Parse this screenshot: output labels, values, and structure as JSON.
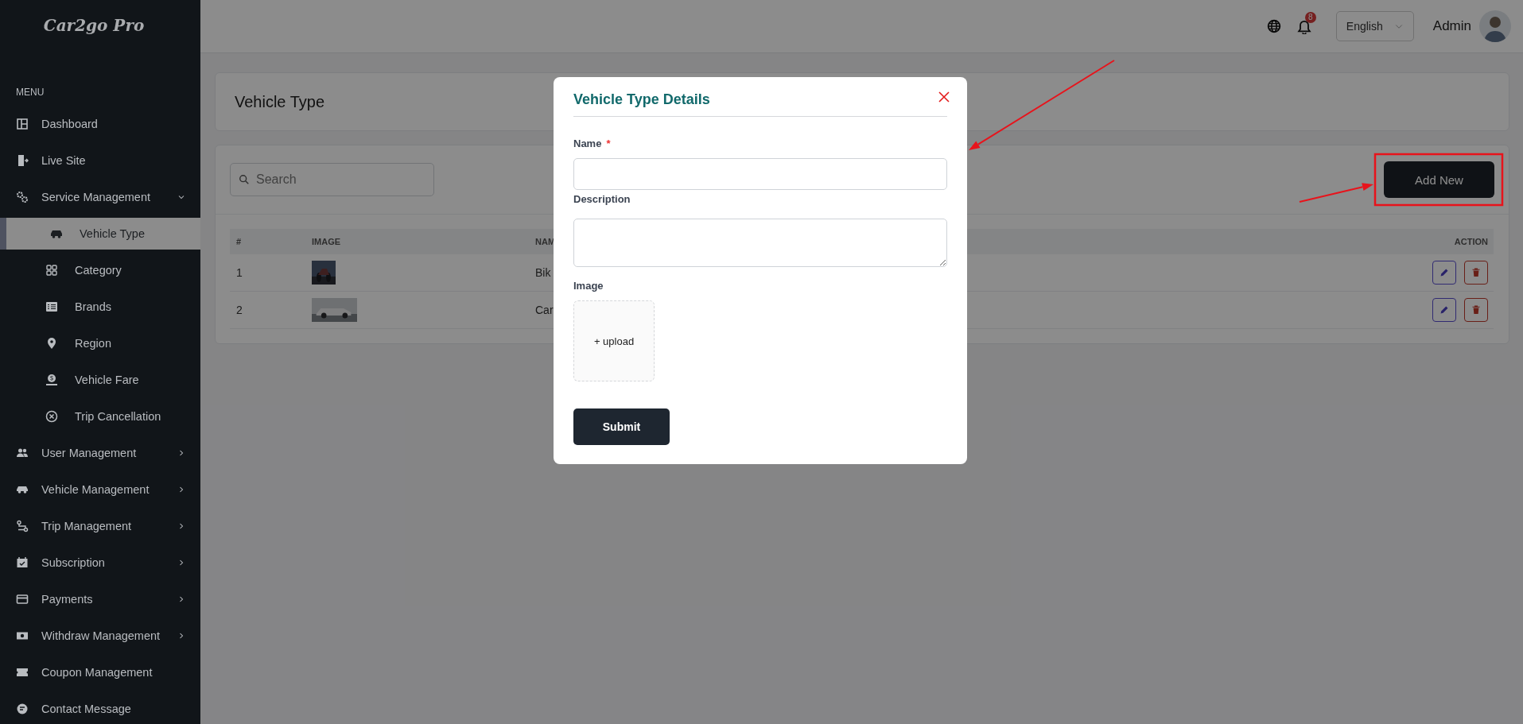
{
  "sidebar": {
    "logo": "Car2go Pro",
    "menu_label": "MENU",
    "items": [
      {
        "label": "Dashboard",
        "kind": "link",
        "selected": false
      },
      {
        "label": "Live Site",
        "kind": "link",
        "selected": false
      },
      {
        "label": "Service Management",
        "kind": "group",
        "expanded": true,
        "selected": false,
        "children": [
          {
            "label": "Vehicle Type",
            "selected": true
          },
          {
            "label": "Category",
            "selected": false
          },
          {
            "label": "Brands",
            "selected": false
          },
          {
            "label": "Region",
            "selected": false
          },
          {
            "label": "Vehicle Fare",
            "selected": false
          },
          {
            "label": "Trip Cancellation",
            "selected": false
          }
        ]
      },
      {
        "label": "User Management",
        "kind": "group",
        "expanded": false,
        "selected": false
      },
      {
        "label": "Vehicle Management",
        "kind": "group",
        "expanded": false,
        "selected": false
      },
      {
        "label": "Trip Management",
        "kind": "group",
        "expanded": false,
        "selected": false
      },
      {
        "label": "Subscription",
        "kind": "group",
        "expanded": false,
        "selected": false
      },
      {
        "label": "Payments",
        "kind": "group",
        "expanded": false,
        "selected": false
      },
      {
        "label": "Withdraw Management",
        "kind": "group",
        "expanded": false,
        "selected": false
      },
      {
        "label": "Coupon Management",
        "kind": "link",
        "selected": false
      },
      {
        "label": "Contact Message",
        "kind": "link",
        "selected": false
      }
    ]
  },
  "header": {
    "notification_count": "8",
    "language": "English",
    "user_name": "Admin"
  },
  "page": {
    "title": "Vehicle Type",
    "search": {
      "placeholder": "Search"
    },
    "add_button": "Add New",
    "table": {
      "columns": [
        "#",
        "IMAGE",
        "NAM",
        "ACTION"
      ],
      "rows": [
        {
          "index": "1",
          "name": "Bik"
        },
        {
          "index": "2",
          "name": "Car"
        }
      ]
    }
  },
  "modal": {
    "title": "Vehicle Type Details",
    "fields": [
      {
        "kind": "input",
        "label": "Name",
        "required_mark": "*"
      },
      {
        "kind": "textarea",
        "label": "Description"
      },
      {
        "kind": "upload",
        "label": "Image",
        "upload_text": "+ upload"
      }
    ],
    "submit": "Submit"
  },
  "annotations": [
    {
      "kind": "arrow"
    },
    {
      "kind": "arrow"
    },
    {
      "kind": "frame"
    }
  ]
}
